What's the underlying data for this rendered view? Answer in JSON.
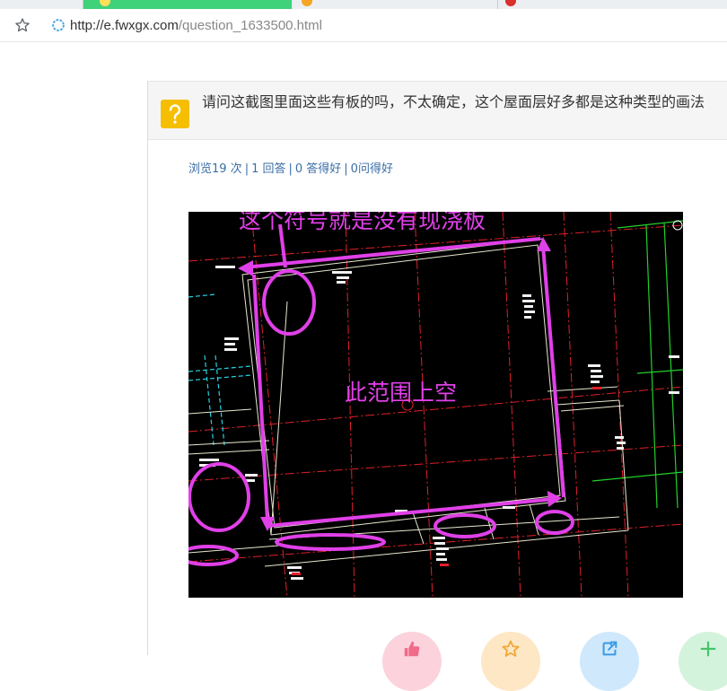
{
  "browser": {
    "url_host": "http://e.fwxgx.com",
    "url_path": "/question_1633500.html"
  },
  "question": {
    "title": "请问这截图里面这些有板的吗，不太确定，这个屋面层好多都是这种类型的画法",
    "stats": {
      "views": "浏览19 次",
      "answers": "1 回答",
      "good_answers": "0 答得好",
      "good_questions": "0问得好"
    }
  },
  "image_annotations": {
    "top_note": "这个符号就是没有现浇板",
    "center_note": "此范围上空"
  },
  "colors": {
    "annotation": "#e040e8",
    "link": "#3a6ea5",
    "question_icon": "#f5bf00",
    "tab_active": "#3fd27a"
  },
  "actions": [
    {
      "icon": "thumbs-up-icon",
      "bg": "#fcd3dc",
      "fg": "#f06a8a"
    },
    {
      "icon": "star-icon",
      "bg": "#fde7c4",
      "fg": "#f0a838"
    },
    {
      "icon": "share-icon",
      "bg": "#cfe8fb",
      "fg": "#3b9be6"
    },
    {
      "icon": "add-icon",
      "bg": "#d4f3dc",
      "fg": "#45c46a"
    }
  ]
}
